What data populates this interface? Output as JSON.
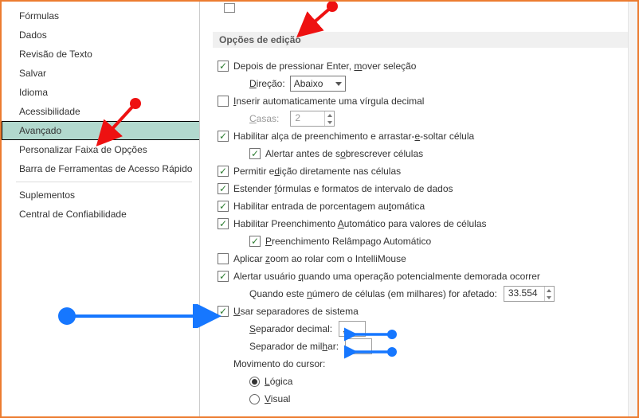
{
  "sidebar": {
    "items": [
      {
        "label": "Fórmulas"
      },
      {
        "label": "Dados"
      },
      {
        "label": "Revisão de Texto"
      },
      {
        "label": "Salvar"
      },
      {
        "label": "Idioma"
      },
      {
        "label": "Acessibilidade"
      },
      {
        "label": "Avançado",
        "selected": true
      },
      {
        "label": "Personalizar Faixa de Opções"
      },
      {
        "label": "Barra de Ferramentas de Acesso Rápido"
      },
      {
        "label": "Suplementos"
      },
      {
        "label": "Central de Confiabilidade"
      }
    ]
  },
  "section_header": "Opções de edição",
  "opts": {
    "move_after_enter": {
      "checked": true,
      "label_pre": "Depois de pressionar Enter, ",
      "label_u": "m",
      "label_post": "over seleção"
    },
    "direction_label_u": "D",
    "direction_label_post": "ireção:",
    "direction_value": "Abaixo",
    "insert_decimal": {
      "checked": false,
      "label_u": "I",
      "label_post": "nserir automaticamente uma vírgula decimal"
    },
    "places_label_u": "C",
    "places_label_post": "asas:",
    "places_value": "2",
    "fill_handle": {
      "checked": true,
      "label_pre": "Habilitar alça de preenchimento e arrastar-",
      "label_u": "e",
      "label_post": "-soltar célula"
    },
    "alert_overwrite": {
      "checked": true,
      "label_pre": "Alertar antes de s",
      "label_u": "o",
      "label_post": "brescrever células"
    },
    "edit_in_cell": {
      "checked": true,
      "label_pre": "Permitir e",
      "label_u": "d",
      "label_post": "ição diretamente nas células"
    },
    "extend_formats": {
      "checked": true,
      "label_pre": "Estender ",
      "label_u": "f",
      "label_post": "órmulas e formatos de intervalo de dados"
    },
    "percent_entry": {
      "checked": true,
      "label_pre": "Habilitar entrada de porcentagem au",
      "label_u": "t",
      "label_post": "omática"
    },
    "autocomplete": {
      "checked": true,
      "label_pre": "Habilitar Preenchimento ",
      "label_u": "A",
      "label_post": "utomático para valores de células"
    },
    "flash_fill": {
      "checked": true,
      "label_u": "P",
      "label_post": "reenchimento Relâmpago Automático"
    },
    "intellimouse": {
      "checked": false,
      "label_pre": "Aplicar ",
      "label_u": "z",
      "label_post": "oom ao rolar com o IntelliMouse"
    },
    "alert_slow": {
      "checked": true,
      "label_pre": "Alertar usuário ",
      "label_u": "q",
      "label_post": "uando uma operação potencialmente demorada ocorrer"
    },
    "cells_label_pre": "Quando este ",
    "cells_label_u": "n",
    "cells_label_post": "úmero de células (em milhares) for afetado:",
    "cells_value": "33.554",
    "use_system_sep": {
      "checked": true,
      "label_u": "U",
      "label_post": "sar separadores de sistema"
    },
    "dec_sep_label_u": "S",
    "dec_sep_label_post": "eparador decimal:",
    "dec_sep_value": ",",
    "thou_sep_label_pre": "Separador de mil",
    "thou_sep_label_u": "h",
    "thou_sep_label_post": "ar:",
    "thou_sep_value": ".",
    "cursor_label": "Movimento do cursor:",
    "cursor_logical_u": "L",
    "cursor_logical_post": "ógica",
    "cursor_visual_u": "V",
    "cursor_visual_post": "isual"
  }
}
